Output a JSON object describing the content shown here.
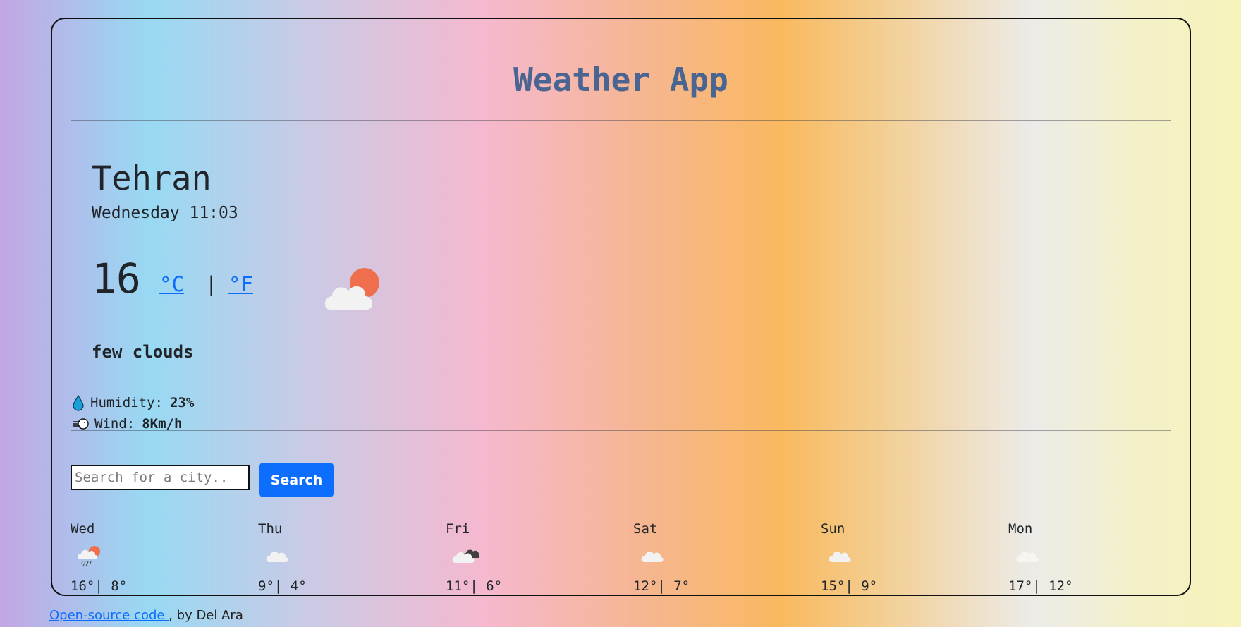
{
  "app": {
    "title": "Weather App"
  },
  "current": {
    "city": "Tehran",
    "datetime": "Wednesday 11:03",
    "temperature": "16",
    "unit_celsius": "°C",
    "unit_separator": "|",
    "unit_fahrenheit": "°F",
    "icon": "few-clouds-day-icon",
    "description": "few clouds",
    "humidity_label": "Humidity:",
    "humidity_value": "23%",
    "wind_label": "Wind:",
    "wind_value": "8Km/h"
  },
  "search": {
    "placeholder": "Search for a city..",
    "value": "",
    "button_label": "Search"
  },
  "forecast": [
    {
      "day": "Wed",
      "icon": "rain-sun-icon",
      "temps": "16°| 8°"
    },
    {
      "day": "Thu",
      "icon": "cloud-icon",
      "temps": "9°| 4°"
    },
    {
      "day": "Fri",
      "icon": "broken-clouds-icon",
      "temps": "11°| 6°"
    },
    {
      "day": "Sat",
      "icon": "cloud-icon",
      "temps": "12°| 7°"
    },
    {
      "day": "Sun",
      "icon": "cloud-icon",
      "temps": "15°| 9°"
    },
    {
      "day": "Mon",
      "icon": "faint-cloud-icon",
      "temps": "17°| 12°"
    }
  ],
  "footer": {
    "link_text": "Open-source code ",
    "suffix": ", by Del Ara"
  },
  "colors": {
    "title": "#4a6591",
    "link": "#0d6efd",
    "button": "#0d6efd",
    "sun": "#ee6e4e",
    "cloud": "#f2f2f2",
    "water_drop": "#1a9fd9"
  }
}
